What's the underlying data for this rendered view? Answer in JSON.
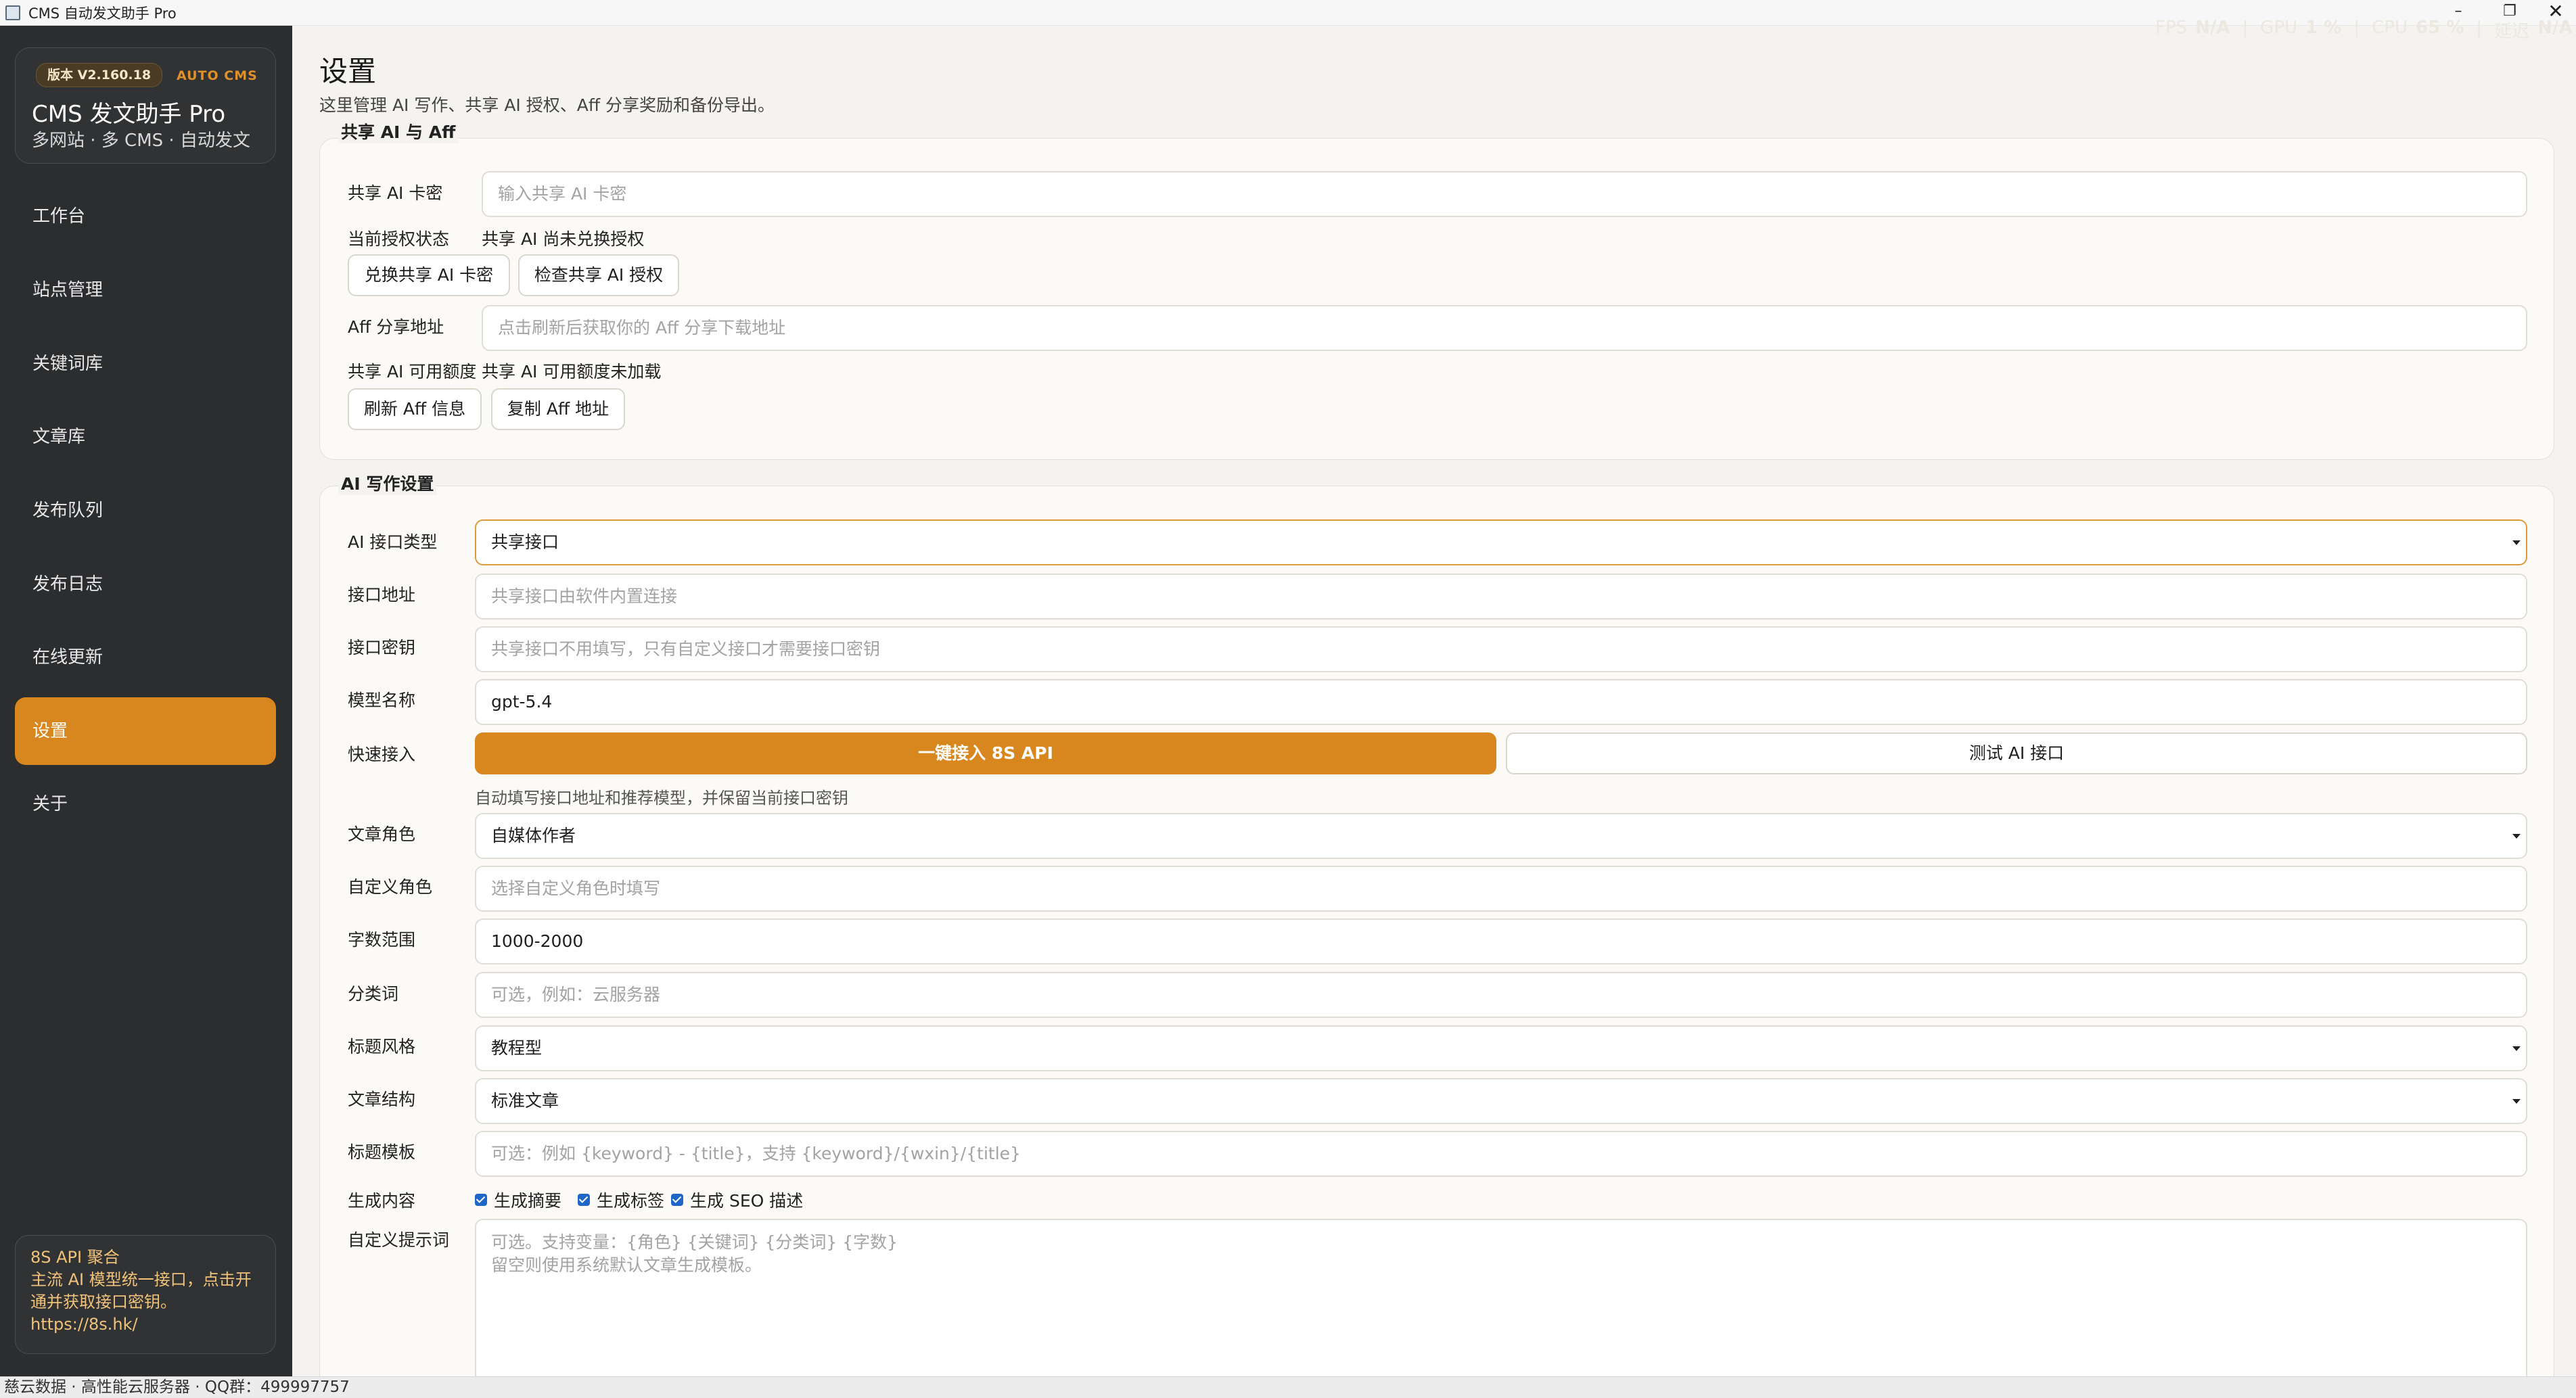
{
  "window": {
    "title": "CMS 自动发文助手 Pro",
    "min_glyph": "–",
    "max_glyph": "❐",
    "close_glyph": "✕"
  },
  "perf": {
    "fps_label": "FPS",
    "fps_value": "N/A",
    "gpu_label": "GPU",
    "gpu_value": "1 %",
    "cpu_label": "CPU",
    "cpu_value": "65 %",
    "extra_label": "延迟",
    "extra_value": "N/A"
  },
  "sidebar": {
    "version": "版本 V2.160.18",
    "tag": "AUTO CMS",
    "app_name": "CMS 发文助手 Pro",
    "app_sub": "多网站 · 多 CMS · 自动发文",
    "items": [
      {
        "label": "工作台"
      },
      {
        "label": "站点管理"
      },
      {
        "label": "关键词库"
      },
      {
        "label": "文章库"
      },
      {
        "label": "发布队列"
      },
      {
        "label": "发布日志"
      },
      {
        "label": "在线更新"
      },
      {
        "label": "设置"
      },
      {
        "label": "关于"
      }
    ],
    "active_index": 7,
    "promo": {
      "title": "8S API 聚合",
      "line1": "主流 AI 模型统一接口，点击开",
      "line2": "通并获取接口密钥。",
      "url": "https://8s.hk/"
    }
  },
  "status_bar": "慈云数据 · 高性能云服务器 · QQ群：499997757",
  "page": {
    "title": "设置",
    "subtitle": "这里管理 AI 写作、共享 AI 授权、Aff 分享奖励和备份导出。"
  },
  "shared_ai": {
    "group_title": "共享 AI 与 Aff",
    "card_label": "共享 AI 卡密",
    "card_placeholder": "输入共享 AI 卡密",
    "auth_label": "当前授权状态",
    "auth_value": "共享 AI 尚未兑换授权",
    "redeem_btn": "兑换共享 AI 卡密",
    "check_btn": "检查共享 AI 授权",
    "aff_label": "Aff 分享地址",
    "aff_placeholder": "点击刷新后获取你的 Aff 分享下载地址",
    "quota_label": "共享 AI 可用额度",
    "quota_value": "共享 AI 可用额度未加载",
    "refresh_btn": "刷新 Aff 信息",
    "copy_btn": "复制 Aff 地址"
  },
  "ai_writing": {
    "group_title": "AI 写作设置",
    "api_type_label": "AI 接口类型",
    "api_type_value": "共享接口",
    "api_url_label": "接口地址",
    "api_url_placeholder": "共享接口由软件内置连接",
    "api_key_label": "接口密钥",
    "api_key_placeholder": "共享接口不用填写，只有自定义接口才需要接口密钥",
    "model_label": "模型名称",
    "model_value": "gpt-5.4",
    "quick_label": "快速接入",
    "quick_btn": "一键接入 8S API",
    "test_btn": "测试 AI 接口",
    "quick_hint": "自动填写接口地址和推荐模型，并保留当前接口密钥",
    "role_label": "文章角色",
    "role_value": "自媒体作者",
    "custom_role_label": "自定义角色",
    "custom_role_placeholder": "选择自定义角色时填写",
    "words_label": "字数范围",
    "words_value": "1000-2000",
    "category_label": "分类词",
    "category_placeholder": "可选，例如：云服务器",
    "title_style_label": "标题风格",
    "title_style_value": "教程型",
    "structure_label": "文章结构",
    "structure_value": "标准文章",
    "title_tpl_label": "标题模板",
    "title_tpl_placeholder": "可选：例如 {keyword} - {title}，支持 {keyword}/{wxin}/{title}",
    "gen_label": "生成内容",
    "gen_summary": "生成摘要",
    "gen_tags": "生成标签",
    "gen_seo": "生成 SEO 描述",
    "prompt_label": "自定义提示词",
    "prompt_placeholder_1": "可选。支持变量：{角色} {关键词} {分类词} {字数}",
    "prompt_placeholder_2": "留空则使用系统默认文章生成模板。"
  }
}
